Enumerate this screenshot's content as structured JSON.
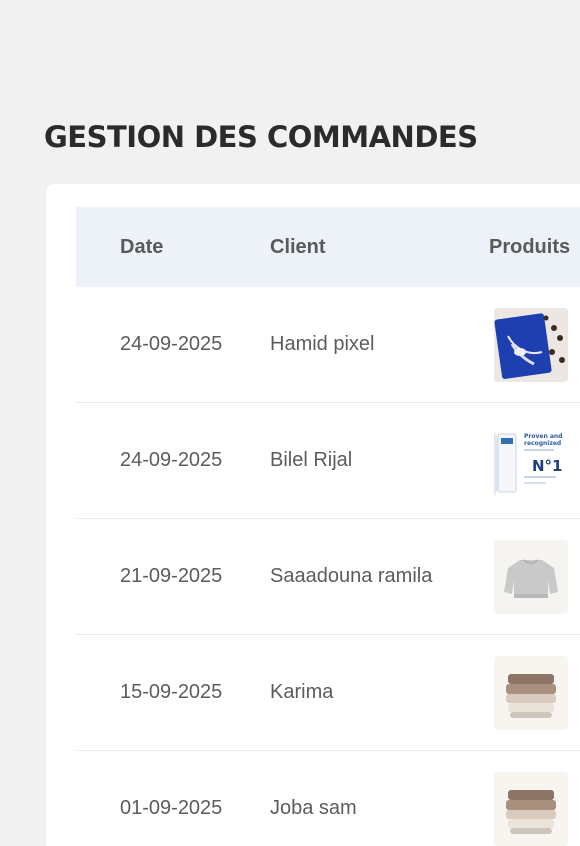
{
  "page": {
    "title": "GESTION DES COMMANDES"
  },
  "table": {
    "headers": {
      "date": "Date",
      "client": "Client",
      "products": "Produits"
    },
    "rows": [
      {
        "date": "24-09-2025",
        "client": "Hamid pixel",
        "product_icon": "necklace-product-icon"
      },
      {
        "date": "24-09-2025",
        "client": "Bilel Rijal",
        "product_icon": "skincare-product-icon"
      },
      {
        "date": "21-09-2025",
        "client": "Saaadouna ramila",
        "product_icon": "sweater-product-icon"
      },
      {
        "date": "15-09-2025",
        "client": "Karima",
        "product_icon": "folded-clothes-product-icon"
      },
      {
        "date": "01-09-2025",
        "client": "Joba sam",
        "product_icon": "folded-clothes-product-icon"
      }
    ]
  },
  "skincare_label": {
    "line1": "Proven and",
    "line2": "recognized",
    "number": "N°1"
  },
  "colors": {
    "background": "#f1f1f1",
    "header_bg": "#edf1f8",
    "text": "#5c5c5c",
    "title": "#2b2b2b"
  }
}
